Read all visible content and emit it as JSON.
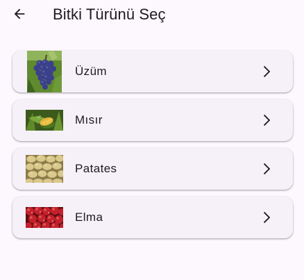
{
  "app_bar": {
    "title": "Bitki Türünü Seç",
    "back_icon": "arrow-back-icon"
  },
  "plants": [
    {
      "label": "Üzüm",
      "image": "grapes-thumbnail"
    },
    {
      "label": "Mısır",
      "image": "corn-thumbnail"
    },
    {
      "label": "Patates",
      "image": "potatoes-thumbnail"
    },
    {
      "label": "Elma",
      "image": "apples-thumbnail"
    }
  ],
  "colors": {
    "background": "#fdf7fe",
    "card": "#f6f0f8",
    "text": "#1d1b20"
  }
}
